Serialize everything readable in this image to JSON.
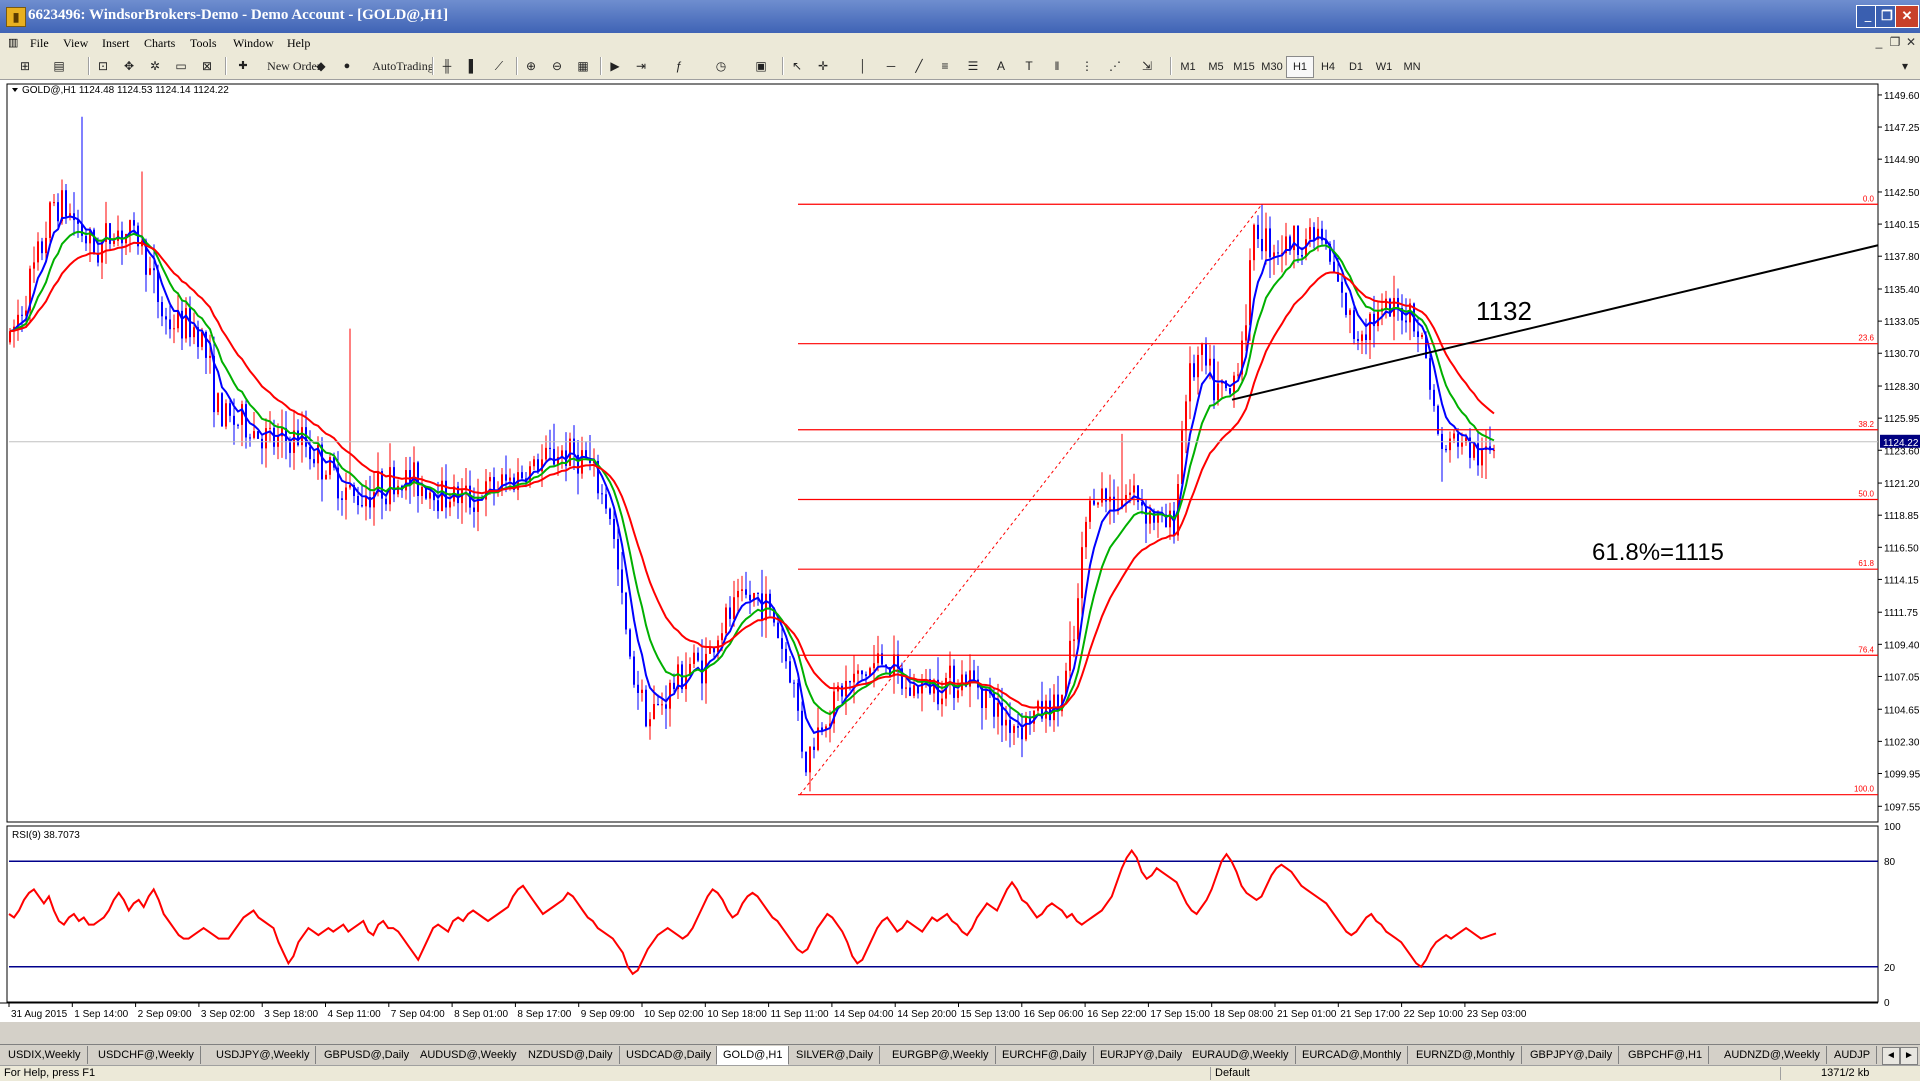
{
  "window": {
    "title": "6623496: WindsorBrokers-Demo - Demo Account - [GOLD@,H1]",
    "minimize": "_",
    "restore": "❐",
    "close": "✕"
  },
  "menu": {
    "items": [
      "File",
      "View",
      "Insert",
      "Charts",
      "Tools",
      "Window",
      "Help"
    ],
    "mdi_minimize": "_",
    "mdi_restore": "❐",
    "mdi_close": "✕"
  },
  "toolbar": {
    "new_order": "New Order",
    "autotrading": "AutoTrading",
    "timeframes": [
      "M1",
      "M5",
      "M15",
      "M30",
      "H1",
      "H4",
      "D1",
      "W1",
      "MN"
    ],
    "active_timeframe": "H1",
    "search": {
      "value": "",
      "placeholder": ""
    }
  },
  "chart": {
    "symbol_info": "GOLD@,H1  1124.48 1124.53 1124.14 1124.22",
    "current_price": "1124.22",
    "colors": {
      "bull": "#ff0000",
      "bear": "#0000ff",
      "ma_fast": "#0000ff",
      "ma_mid": "#00b000",
      "ma_slow": "#ff0000",
      "fib": "#ff0000",
      "trendline": "#000000",
      "rsi": "#ff0000",
      "rsi_level": "#00008b",
      "price_badge": "#000080"
    },
    "annotations": {
      "level_1132": "1132",
      "fib_618": "61.8%=1115"
    },
    "price_axis": [
      "1149.60",
      "1147.25",
      "1144.90",
      "1142.50",
      "1140.15",
      "1137.80",
      "1135.40",
      "1133.05",
      "1130.70",
      "1128.30",
      "1125.95",
      "1123.60",
      "1121.20",
      "1118.85",
      "1116.50",
      "1114.15",
      "1111.75",
      "1109.40",
      "1107.05",
      "1104.65",
      "1102.30",
      "1099.95",
      "1097.55"
    ],
    "fib_levels": [
      {
        "label": "0.0",
        "price": 1141.6
      },
      {
        "label": "23.6",
        "price": 1131.4
      },
      {
        "label": "38.2",
        "price": 1125.1
      },
      {
        "label": "50.0",
        "price": 1120.0
      },
      {
        "label": "61.8",
        "price": 1114.9
      },
      {
        "label": "76.4",
        "price": 1108.6
      },
      {
        "label": "100.0",
        "price": 1098.4
      }
    ],
    "time_axis": [
      "31 Aug 2015",
      "1 Sep 14:00",
      "2 Sep 09:00",
      "3 Sep 02:00",
      "3 Sep 18:00",
      "4 Sep 11:00",
      "7 Sep 04:00",
      "8 Sep 01:00",
      "8 Sep 17:00",
      "9 Sep 09:00",
      "10 Sep 02:00",
      "10 Sep 18:00",
      "11 Sep 11:00",
      "14 Sep 04:00",
      "14 Sep 20:00",
      "15 Sep 13:00",
      "16 Sep 06:00",
      "16 Sep 22:00",
      "17 Sep 15:00",
      "18 Sep 08:00",
      "21 Sep 01:00",
      "21 Sep 17:00",
      "22 Sep 10:00",
      "23 Sep 03:00"
    ]
  },
  "rsi": {
    "label": "RSI(9) 38.7073",
    "axis": [
      "100",
      "80",
      "20",
      "0"
    ],
    "values": [
      50,
      48,
      52,
      58,
      62,
      64,
      60,
      56,
      60,
      52,
      46,
      44,
      48,
      50,
      46,
      48,
      44,
      44,
      46,
      48,
      52,
      58,
      62,
      58,
      52,
      56,
      58,
      54,
      60,
      64,
      58,
      50,
      46,
      42,
      38,
      36,
      36,
      38,
      40,
      42,
      40,
      38,
      36,
      36,
      36,
      40,
      44,
      48,
      50,
      52,
      48,
      46,
      44,
      42,
      34,
      28,
      22,
      26,
      34,
      38,
      42,
      40,
      38,
      40,
      42,
      40,
      42,
      44,
      40,
      42,
      44,
      46,
      40,
      38,
      44,
      46,
      42,
      42,
      40,
      36,
      32,
      28,
      24,
      30,
      36,
      42,
      44,
      42,
      40,
      46,
      48,
      46,
      50,
      52,
      50,
      48,
      46,
      48,
      50,
      52,
      54,
      60,
      64,
      66,
      62,
      58,
      54,
      50,
      52,
      54,
      56,
      58,
      62,
      60,
      56,
      52,
      48,
      46,
      42,
      40,
      38,
      36,
      32,
      28,
      20,
      16,
      18,
      24,
      30,
      34,
      38,
      40,
      42,
      40,
      38,
      36,
      38,
      42,
      48,
      54,
      60,
      64,
      62,
      58,
      52,
      48,
      50,
      56,
      60,
      62,
      60,
      56,
      52,
      48,
      46,
      42,
      38,
      34,
      30,
      28,
      30,
      36,
      42,
      46,
      50,
      48,
      44,
      40,
      34,
      26,
      22,
      24,
      30,
      36,
      42,
      46,
      48,
      44,
      40,
      42,
      46,
      44,
      42,
      40,
      44,
      48,
      46,
      48,
      50,
      46,
      44,
      40,
      38,
      42,
      48,
      52,
      56,
      54,
      52,
      58,
      64,
      68,
      64,
      58,
      56,
      52,
      48,
      50,
      54,
      56,
      54,
      52,
      48,
      50,
      46,
      44,
      46,
      48,
      50,
      52,
      56,
      60,
      68,
      76,
      82,
      86,
      82,
      74,
      70,
      72,
      76,
      74,
      72,
      70,
      68,
      62,
      56,
      52,
      50,
      54,
      58,
      64,
      72,
      80,
      84,
      80,
      74,
      66,
      62,
      60,
      58,
      60,
      66,
      72,
      76,
      78,
      76,
      74,
      70,
      66,
      64,
      62,
      60,
      58,
      56,
      52,
      48,
      44,
      40,
      38,
      40,
      44,
      48,
      50,
      46,
      44,
      40,
      38,
      36,
      34,
      30,
      26,
      22,
      20,
      24,
      30,
      34,
      36,
      38,
      36,
      38,
      40,
      42,
      40,
      38,
      36,
      37,
      38,
      39
    ],
    "level_high": 80,
    "level_low": 20
  },
  "tabs": {
    "items": [
      "USDIX,Weekly",
      "USDCHF@,Weekly",
      "USDJPY@,Weekly",
      "GBPUSD@,Daily",
      "AUDUSD@,Weekly",
      "NZDUSD@,Daily",
      "USDCAD@,Daily",
      "GOLD@,H1",
      "SILVER@,Daily",
      "EURGBP@,Weekly",
      "EURCHF@,Daily",
      "EURJPY@,Daily",
      "EURAUD@,Weekly",
      "EURCAD@,Monthly",
      "EURNZD@,Monthly",
      "GBPJPY@,Daily",
      "GBPCHF@,H1",
      "AUDNZD@,Weekly",
      "AUDJP"
    ],
    "active": "GOLD@,H1",
    "scroll_left": "◄",
    "scroll_right": "►"
  },
  "status": {
    "help": "For Help, press F1",
    "profile": "Default",
    "traffic": "1371/2 kb"
  }
}
